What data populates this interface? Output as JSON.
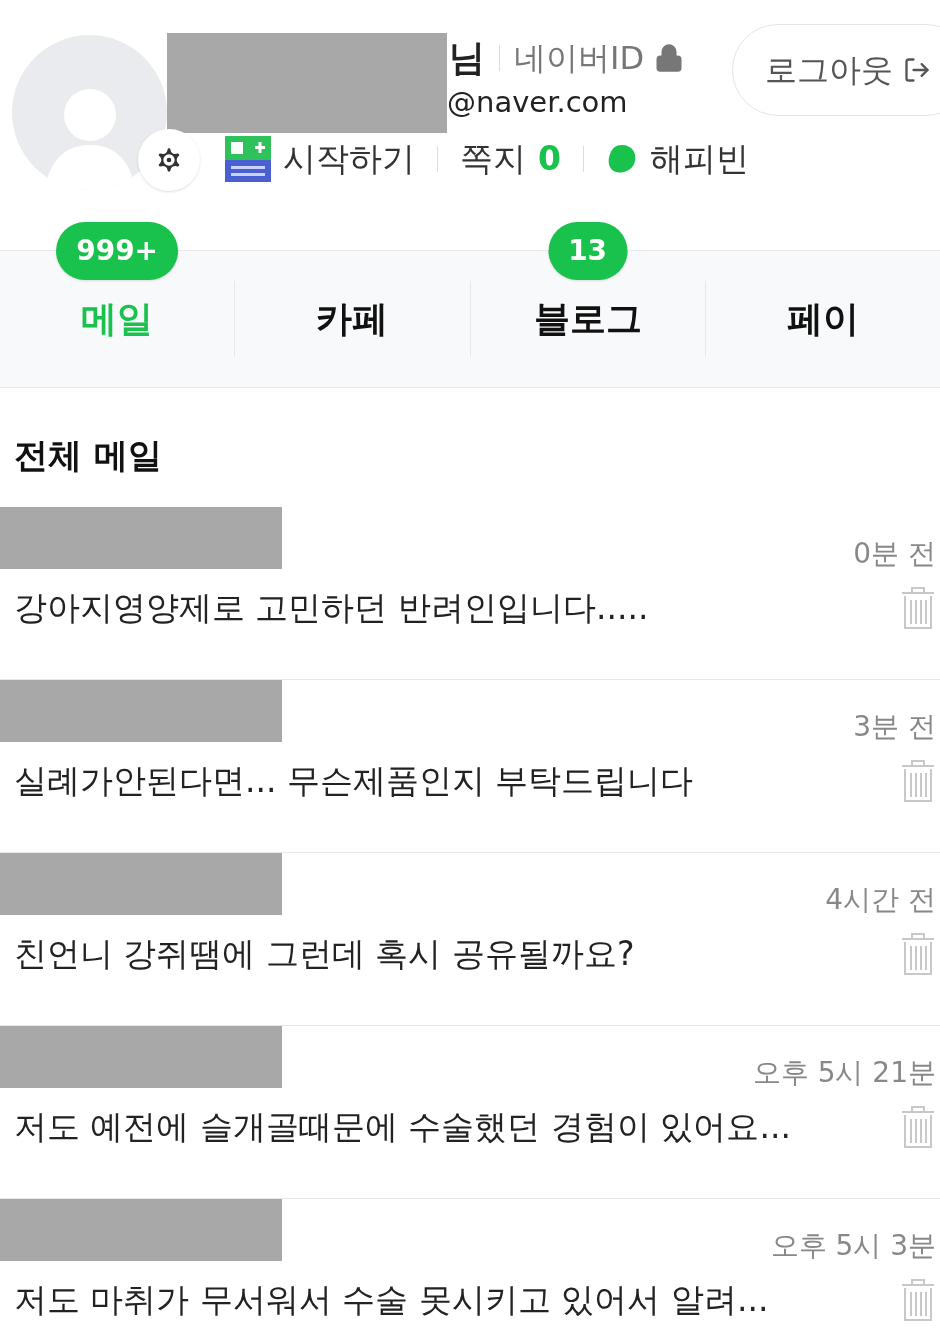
{
  "profile": {
    "name_suffix": "님",
    "id_label": "네이버ID",
    "email_suffix": "@naver.com",
    "logout": "로그아웃",
    "links": [
      {
        "kind": "naverplus",
        "label": "시작하기"
      },
      {
        "kind": "note",
        "label": "쪽지",
        "count": "0"
      },
      {
        "kind": "happybean",
        "label": "해피빈"
      }
    ]
  },
  "tabs": [
    {
      "label": "메일",
      "badge": "999+",
      "selected": true
    },
    {
      "label": "카페",
      "selected": false
    },
    {
      "label": "블로그",
      "badge": "13",
      "selected": false
    },
    {
      "label": "페이",
      "selected": false
    }
  ],
  "section_title": "전체 메일",
  "mails": [
    {
      "subject": "강아지영양제로 고민하던 반려인입니다.....",
      "time": "0분 전"
    },
    {
      "subject": "실례가안된다면... 무슨제품인지 부탁드립니다",
      "time": "3분 전"
    },
    {
      "subject": "친언니 강쥐땜에 그런데 혹시 공유될까요?",
      "time": "4시간 전"
    },
    {
      "subject": "저도 예전에 슬개골때문에 수술했던 경험이 있어요...",
      "time": "오후 5시 21분"
    },
    {
      "subject": "저도 마취가 무서워서 수술 못시키고 있어서 알려...",
      "time": "오후 5시 3분"
    }
  ]
}
